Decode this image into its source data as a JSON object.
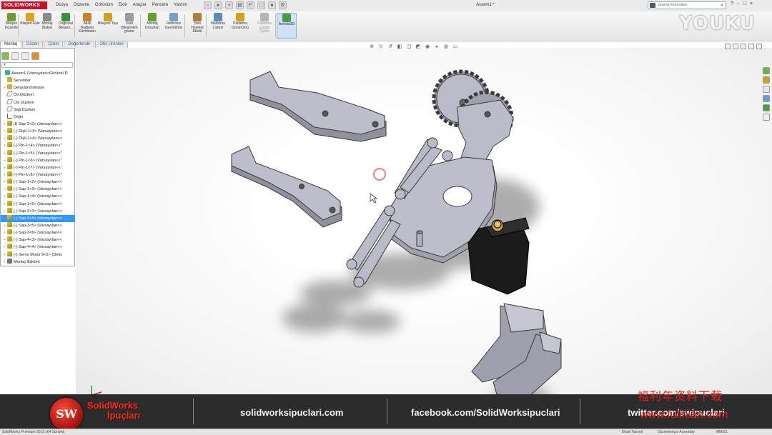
{
  "app": {
    "logo": "SOLIDWORKS",
    "document_title": "Assem1 *",
    "menus": [
      "Dosya",
      "Düzenle",
      "Görünüm",
      "Ekle",
      "Araçlar",
      "Pencere",
      "Yardım"
    ],
    "search_placeholder": "arama Komutları",
    "window_controls": [
      "?",
      "–",
      "□",
      "×"
    ]
  },
  "overlay": {
    "youku": "YOUKU",
    "cn_watermark": "福利年资料下载",
    "cn_url": "www.fulinian.com"
  },
  "commands": [
    {
      "label": "Bileşen Düzenle",
      "color": "#6a9c2f"
    },
    {
      "label": "Bileşen Ekle",
      "color": "#d9a520"
    },
    {
      "label": "Montaj Bişkisi",
      "color": "#8a8a8a"
    },
    {
      "label": "Doğrusal Bileşen...",
      "color": "#3b8f3b"
    },
    {
      "label": "Akıllı Bağlantı Elemanları",
      "color": "#c8842a"
    },
    {
      "label": "Bileşeni Taşı",
      "color": "#d0a21c"
    },
    {
      "label": "Gizli Bileşenleri göster",
      "color": "#9b9b9b"
    },
    {
      "label": "Montaj Unsurları",
      "color": "#6a9c2f"
    },
    {
      "label": "Referans Geometrisi",
      "color": "#7aa0c8"
    },
    {
      "label": "Yeni Hareket Etüdü",
      "color": "#b07c3c"
    },
    {
      "label": "Malzeme Listesi",
      "color": "#5a8ac0"
    },
    {
      "label": "Patlatma Görünümü",
      "color": "#d4a01e"
    },
    {
      "label": "Patlatma Çizgisi Çizimi",
      "color": "#b5b5b5"
    },
    {
      "label": "Anında3D",
      "color": "#4a9a4a"
    }
  ],
  "tabs": [
    "Montaj",
    "Düzen",
    "Çizim",
    "Değerlendir",
    "Ofis Ürünleri"
  ],
  "tree": [
    {
      "label": "Assem1  (Varsayılan<Görüntü D",
      "icon": "assem",
      "pm": ""
    },
    {
      "label": "Sensörler",
      "icon": "folder",
      "pm": ""
    },
    {
      "label": "Detaylandırmalar",
      "icon": "folder",
      "pm": "+"
    },
    {
      "label": "Ön Düzlem",
      "icon": "plane",
      "pm": ""
    },
    {
      "label": "Üst Düzlem",
      "icon": "plane",
      "pm": ""
    },
    {
      "label": "Sağ Düzlem",
      "icon": "plane",
      "pm": ""
    },
    {
      "label": "Orijin",
      "icon": "origin",
      "pm": ""
    },
    {
      "label": "(f) Sap-2<2> (Varsayılan<<",
      "icon": "part",
      "pm": "+"
    },
    {
      "label": "(-) Dişli-1<3> (Varsayılan<<",
      "icon": "part",
      "pm": "+"
    },
    {
      "label": "(-) Dişli-1<4> (Varsayılan<<",
      "icon": "part",
      "pm": "+"
    },
    {
      "label": "(-) Pin-1<4> (Varsayılan<<\"",
      "icon": "part",
      "pm": "+"
    },
    {
      "label": "(-) Pin-1<5> (Varsayılan<<\"",
      "icon": "part",
      "pm": "+"
    },
    {
      "label": "(-) Pin-1<6> (Varsayılan<<\"",
      "icon": "part",
      "pm": "+"
    },
    {
      "label": "(-) Pin-1<7> (Varsayılan<<\"",
      "icon": "part",
      "pm": "+"
    },
    {
      "label": "(-) Pin-1<8> (Varsayılan<<\"",
      "icon": "part",
      "pm": "+"
    },
    {
      "label": "(-) Sap-1<2> (Varsayılan<<",
      "icon": "part",
      "pm": "+"
    },
    {
      "label": "(-) Sap-1<3> (Varsayılan<<",
      "icon": "part",
      "pm": "+"
    },
    {
      "label": "(-) Sap-1<4> (Varsayılan<<",
      "icon": "part",
      "pm": "+"
    },
    {
      "label": "(-) Sap-1<5> (Varsayılan<<",
      "icon": "part",
      "pm": "+"
    },
    {
      "label": "(-) Sap-3<3> (Varsayılan<<",
      "icon": "part",
      "pm": "+"
    },
    {
      "label": "(-) Sap-3<4> (Varsayılan<<",
      "icon": "part",
      "pm": "+",
      "selected": true
    },
    {
      "label": "(-) Sap-3<5> (Varsayılan<<",
      "icon": "part",
      "pm": "+"
    },
    {
      "label": "(-) Sap-3<6> (Varsayılan<<",
      "icon": "part",
      "pm": "+"
    },
    {
      "label": "(-) Sap-4<3> (Varsayılan<<",
      "icon": "part",
      "pm": "+"
    },
    {
      "label": "(-) Sap-4<4> (Varsayılan<<",
      "icon": "part",
      "pm": "+"
    },
    {
      "label": "(-) Servo Motor 6<2> (Defa",
      "icon": "part",
      "pm": "+"
    },
    {
      "label": "Montaj İlişkileri",
      "icon": "mates",
      "pm": "+"
    }
  ],
  "banner": {
    "brand_line1": "SolidWorks",
    "brand_line2": "İpuçları",
    "logo_text": "SW",
    "links": [
      "solidworksipuclari.com",
      "facebook.com/SolidWorksipuclari",
      "twitter.com/swipuclari"
    ]
  },
  "status": {
    "app_version": "SolidWorks Premium 2012 x64 Sürümü",
    "mode": "Eksik Tanımlı",
    "editing": "Düzenleniyor Assembly",
    "units": "MMGS"
  },
  "colors": {
    "part_fill": "#b9bcc8",
    "part_edge": "#3a3a3a",
    "servo": "#1b1b1b",
    "selection": "#3399ff",
    "brand_red": "#f2331c"
  }
}
